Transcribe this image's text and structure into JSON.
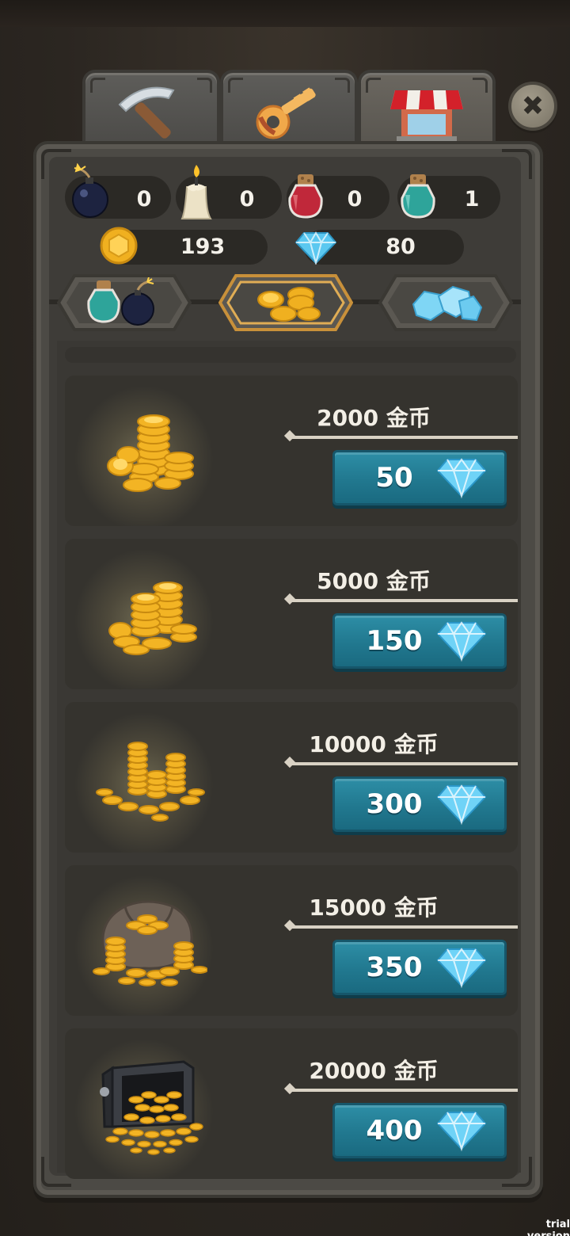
{
  "top_tabs": [
    {
      "name": "tools",
      "icon": "pickaxe-icon"
    },
    {
      "name": "keys",
      "icon": "key-icon"
    },
    {
      "name": "shop",
      "icon": "shop-stall-icon",
      "active": true
    }
  ],
  "close": {
    "label": "✖"
  },
  "resources": {
    "bomb": "0",
    "candle": "0",
    "red_potion": "0",
    "teal_potion": "1",
    "coins": "193",
    "gems": "80"
  },
  "categories": [
    {
      "name": "items",
      "icon": "potion-bomb-icon"
    },
    {
      "name": "coins",
      "icon": "coins-icon",
      "active": true
    },
    {
      "name": "gems",
      "icon": "gems-icon"
    }
  ],
  "offers": [
    {
      "label": "2000 金币",
      "price": "50",
      "icon": "coin-stack-small-icon"
    },
    {
      "label": "5000 金币",
      "price": "150",
      "icon": "coin-stack-medium-icon"
    },
    {
      "label": "10000 金币",
      "price": "300",
      "icon": "coin-pile-icon"
    },
    {
      "label": "15000 金币",
      "price": "350",
      "icon": "coin-sack-icon"
    },
    {
      "label": "20000 金币",
      "price": "400",
      "icon": "coin-vault-icon"
    }
  ],
  "watermark": "trial version",
  "colors": {
    "panel": "#4c4a45",
    "button": "#21788f",
    "gem": "#5bc8f0",
    "gold": "#f5b82a"
  }
}
